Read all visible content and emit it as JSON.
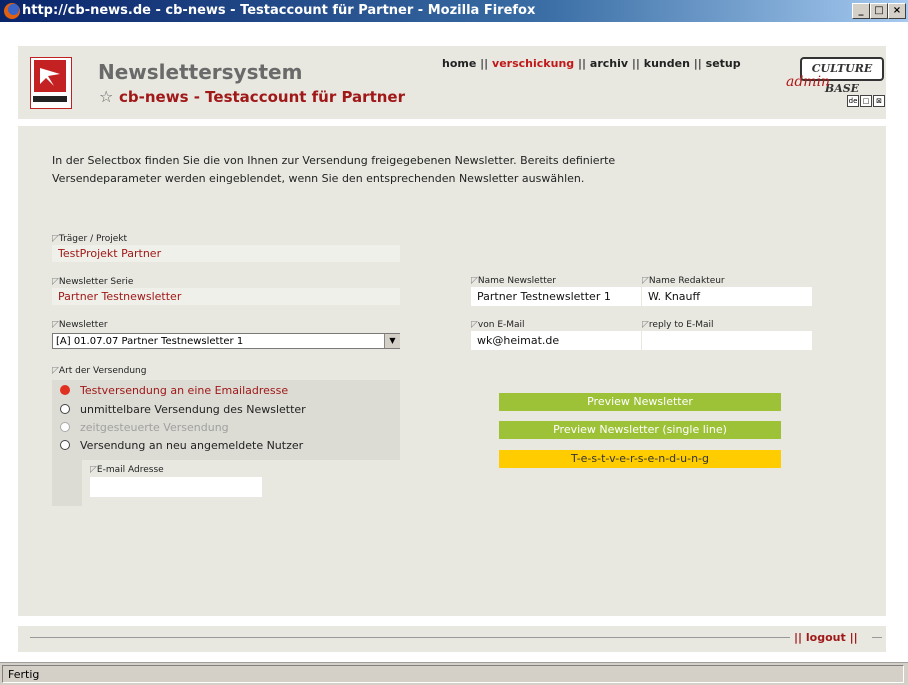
{
  "window": {
    "title": "http://cb-news.de - cb-news - Testaccount für Partner - Mozilla Firefox",
    "buttons": {
      "minimize": "_",
      "maximize": "□",
      "close": "×"
    }
  },
  "header": {
    "app_title": "Newslettersystem",
    "account_title": "cb-news - Testaccount für Partner",
    "star_icon": "☆",
    "nav": [
      {
        "label": "home",
        "active": false
      },
      {
        "label": "verschickung",
        "active": true
      },
      {
        "label": "archiv",
        "active": false
      },
      {
        "label": "kunden",
        "active": false
      },
      {
        "label": "setup",
        "active": false
      }
    ],
    "separator": "||",
    "brand_name": "CULTURE BASE",
    "brand_sub": "admin",
    "lang_flags": [
      "de",
      "□",
      "⊠"
    ]
  },
  "intro": "In der Selectbox finden Sie die von Ihnen zur Versendung freigegebenen Newsletter. Bereits definierte Versendeparameter werden eingeblendet, wenn Sie den entsprechenden Newsletter auswählen.",
  "form": {
    "traeger_label": "Träger / Projekt",
    "traeger_value": "TestProjekt Partner",
    "serie_label": "Newsletter Serie",
    "serie_value": "Partner Testnewsletter",
    "newsletter_label": "Newsletter",
    "newsletter_selected": "[A] 01.07.07 Partner Testnewsletter 1",
    "art_label": "Art der Versendung",
    "options": [
      {
        "label": "Testversendung an eine Emailadresse",
        "state": "selected"
      },
      {
        "label": "unmittelbare Versendung des Newsletter",
        "state": "normal"
      },
      {
        "label": "zeitgesteuerte Versendung",
        "state": "disabled"
      },
      {
        "label": "Versendung an neu angemeldete Nutzer",
        "state": "normal"
      }
    ],
    "email_label": "E-mail Adresse",
    "email_value": "",
    "name_newsletter_label": "Name Newsletter",
    "name_newsletter_value": "Partner Testnewsletter 1",
    "name_redakteur_label": "Name Redakteur",
    "name_redakteur_value": "W. Knauff",
    "von_email_label": "von E-Mail",
    "von_email_value": "wk@heimat.de",
    "reply_email_label": "reply to E-Mail",
    "reply_email_value": ""
  },
  "buttons": {
    "preview": "Preview Newsletter",
    "preview_single": "Preview Newsletter (single line)",
    "test_send": "T-e-s-t-v-e-r-s-e-n-d-u-n-g"
  },
  "footer": {
    "logout": "logout",
    "separator": "||"
  },
  "status": "Fertig",
  "colors": {
    "accent_red": "#a01818",
    "panel": "#e8e8e1",
    "green_button": "#9dc238",
    "yellow_button": "#ffcc00"
  }
}
